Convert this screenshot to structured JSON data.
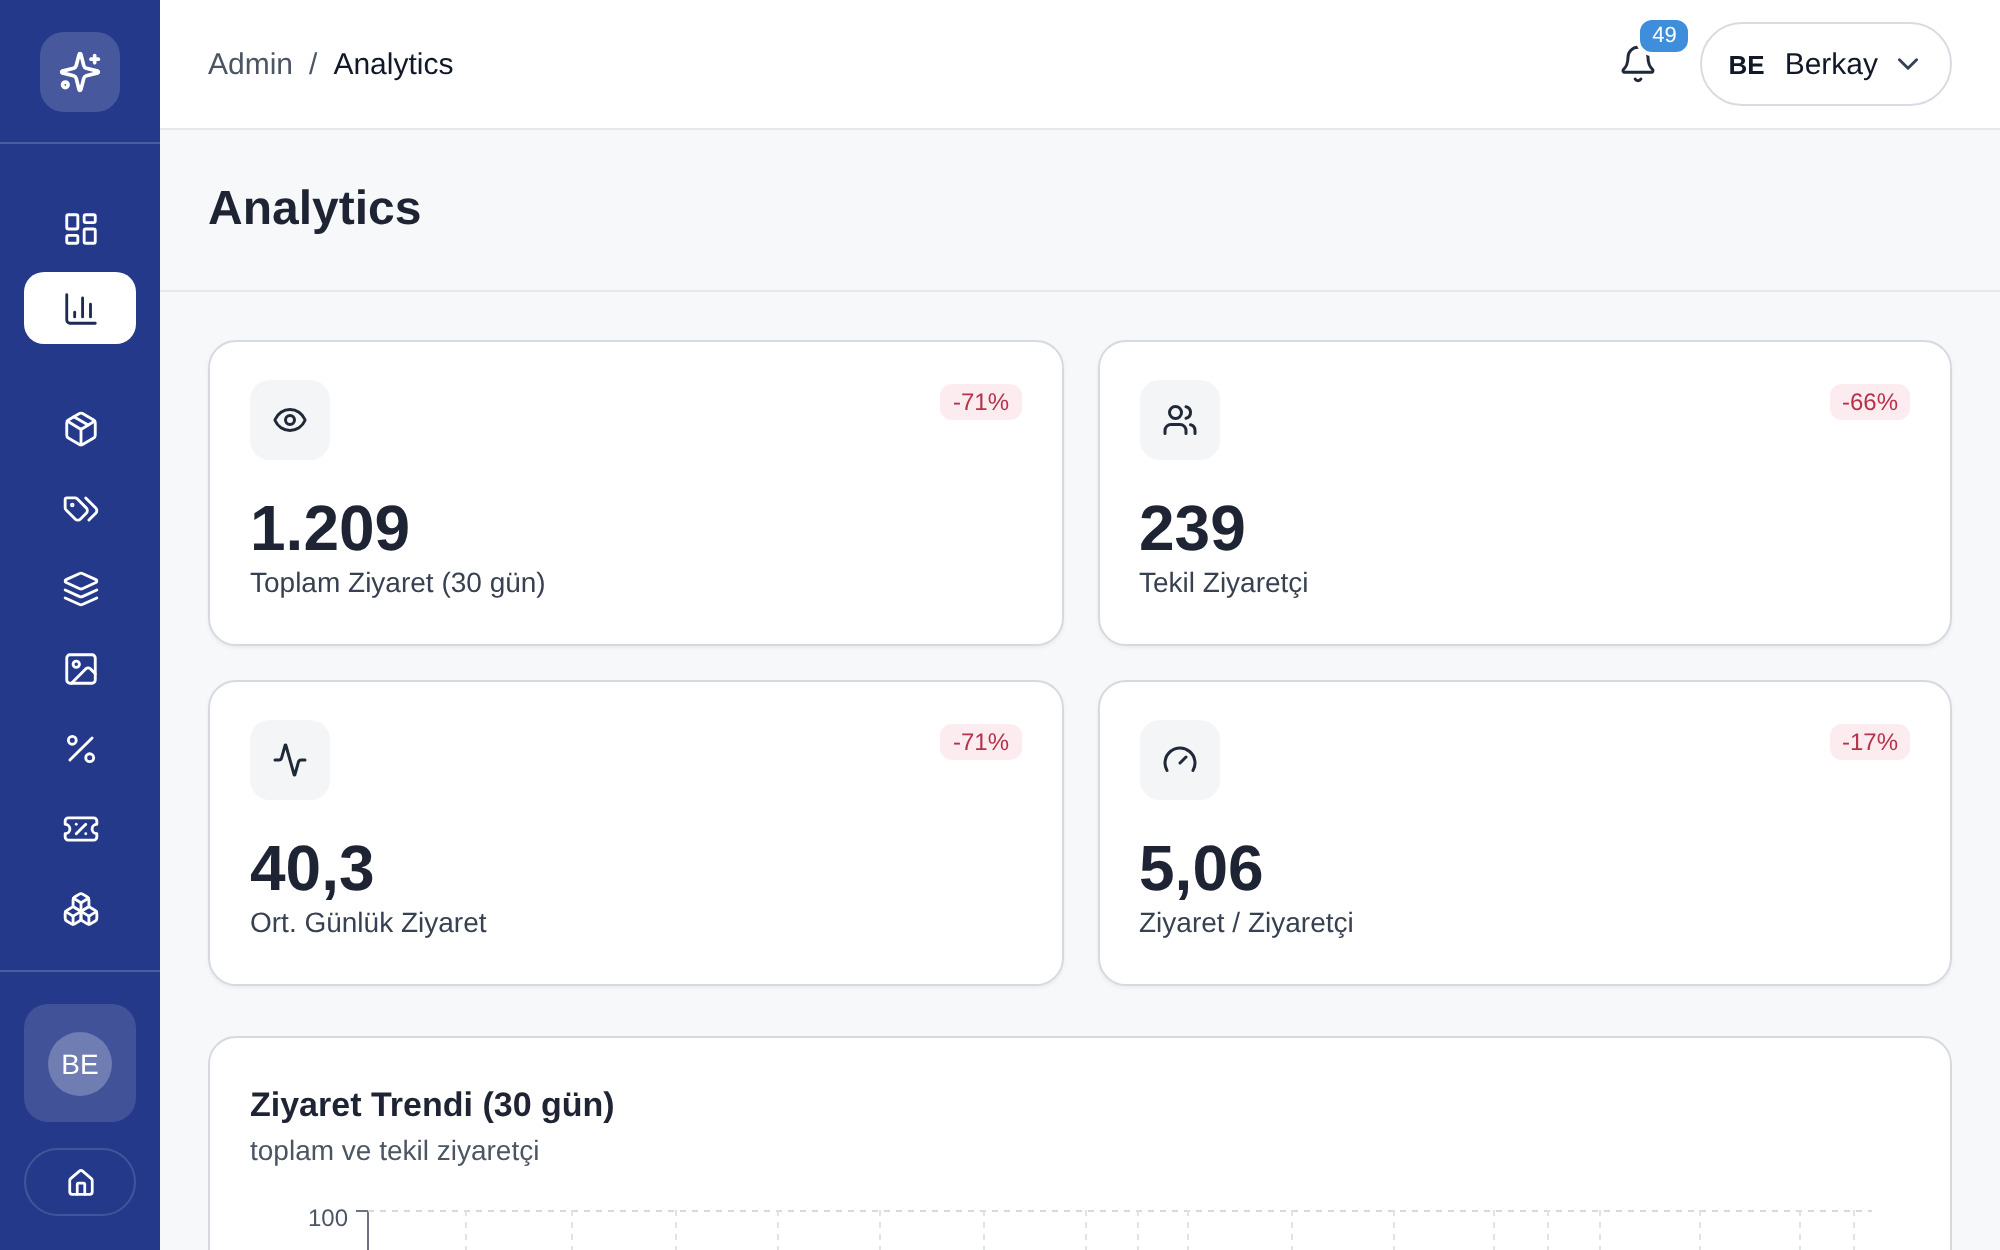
{
  "sidebar": {
    "nav_groups": [
      {
        "items": [
          {
            "selected": false
          },
          {
            "selected": true
          }
        ]
      },
      {
        "items": [
          {
            "selected": false
          },
          {
            "selected": false
          },
          {
            "selected": false
          },
          {
            "selected": false
          },
          {
            "selected": false
          },
          {
            "selected": false
          },
          {
            "selected": false
          }
        ]
      }
    ],
    "user": {
      "initials": "BE"
    }
  },
  "header": {
    "breadcrumb": {
      "items": [
        "Admin",
        "Analytics"
      ],
      "separator": "/"
    },
    "notifications": {
      "count": "49"
    },
    "user": {
      "initials": "BE",
      "name": "Berkay"
    }
  },
  "page": {
    "title": "Analytics"
  },
  "stats": [
    {
      "value": "1.209",
      "label": "Toplam Ziyaret (30 gün)",
      "change": "-71%",
      "negative": true
    },
    {
      "value": "239",
      "label": "Tekil Ziyaretçi",
      "change": "-66%",
      "negative": true
    },
    {
      "value": "40,3",
      "label": "Ort. Günlük Ziyaret",
      "change": "-71%",
      "negative": true
    },
    {
      "value": "5,06",
      "label": "Ziyaret / Ziyaretçi",
      "change": "-17%",
      "negative": true
    }
  ],
  "chart": {
    "title": "Ziyaret Trendi (30 gün)",
    "subtitle": "toplam ve tekil ziyaretçi",
    "y_tick_labels": [
      "100"
    ]
  }
}
